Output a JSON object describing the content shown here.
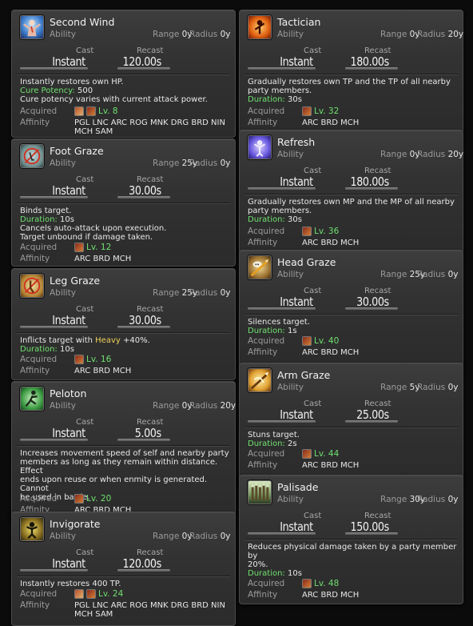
{
  "labels": {
    "cast": "Cast",
    "recast": "Recast",
    "range": "Range",
    "radius": "Radius",
    "acquired": "Acquired",
    "affinity": "Affinity"
  },
  "left": [
    {
      "name": "Second Wind",
      "type": "Ability",
      "range": "0y",
      "radius": "0y",
      "cast": "Instant",
      "recast": "120.00s",
      "desc_line1": "Instantly restores own HP.",
      "potency_label": "Cure Potency:",
      "potency_value": "500",
      "desc_line3": "Cure potency varies with current attack power.",
      "level": "Lv. 8",
      "affinity": "PGL LNC ARC ROG MNK DRG BRD NIN MCH SAM",
      "icon": "second-wind-icon"
    },
    {
      "name": "Foot Graze",
      "type": "Ability",
      "range": "25y",
      "radius": "0y",
      "cast": "Instant",
      "recast": "30.00s",
      "desc_line1": "Binds target.",
      "duration_label": "Duration:",
      "duration_value": "10s",
      "desc_line3": "Cancels auto-attack upon execution.",
      "desc_line4": "Target unbound if damage taken.",
      "level": "Lv. 12",
      "affinity": "ARC BRD MCH",
      "icon": "foot-graze-icon"
    },
    {
      "name": "Leg Graze",
      "type": "Ability",
      "range": "25y",
      "radius": "0y",
      "cast": "Instant",
      "recast": "30.00s",
      "desc_pre": "Inflicts target with ",
      "desc_heavy": "Heavy",
      "desc_post": " +40%.",
      "duration_label": "Duration:",
      "duration_value": "10s",
      "level": "Lv. 16",
      "affinity": "ARC BRD MCH",
      "icon": "leg-graze-icon"
    },
    {
      "name": "Peloton",
      "type": "Ability",
      "range": "0y",
      "radius": "20y",
      "cast": "Instant",
      "recast": "5.00s",
      "desc_line1": "Increases movement speed of self and nearby party",
      "desc_line2": "members as long as they remain within distance. Effect",
      "desc_line3": "ends upon reuse or when enmity is generated. Cannot",
      "desc_line4": "be used in battle.",
      "level": "Lv. 20",
      "affinity": "ARC BRD MCH",
      "icon": "peloton-icon"
    },
    {
      "name": "Invigorate",
      "type": "Ability",
      "range": "0y",
      "radius": "0y",
      "cast": "Instant",
      "recast": "120.00s",
      "desc_line1": "Instantly restores 400 TP.",
      "level": "Lv. 24",
      "affinity": "PGL LNC ARC ROG MNK DRG BRD NIN MCH SAM",
      "icon": "invigorate-icon"
    }
  ],
  "right": [
    {
      "name": "Tactician",
      "type": "Ability",
      "range": "0y",
      "radius": "20y",
      "cast": "Instant",
      "recast": "180.00s",
      "desc_line1": "Gradually restores own TP and the TP of all nearby",
      "desc_line2": "party members.",
      "duration_label": "Duration:",
      "duration_value": "30s",
      "level": "Lv. 32",
      "affinity": "ARC BRD MCH",
      "icon": "tactician-icon"
    },
    {
      "name": "Refresh",
      "type": "Ability",
      "range": "0y",
      "radius": "20y",
      "cast": "Instant",
      "recast": "180.00s",
      "desc_line1": "Gradually restores own MP and the MP of all nearby",
      "desc_line2": "party members.",
      "duration_label": "Duration:",
      "duration_value": "30s",
      "level": "Lv. 36",
      "affinity": "ARC BRD MCH",
      "icon": "refresh-icon"
    },
    {
      "name": "Head Graze",
      "type": "Ability",
      "range": "25y",
      "radius": "0y",
      "cast": "Instant",
      "recast": "30.00s",
      "desc_line1": "Silences target.",
      "duration_label": "Duration:",
      "duration_value": "1s",
      "level": "Lv. 40",
      "affinity": "ARC BRD MCH",
      "icon": "head-graze-icon"
    },
    {
      "name": "Arm Graze",
      "type": "Ability",
      "range": "5y",
      "radius": "0y",
      "cast": "Instant",
      "recast": "25.00s",
      "desc_line1": "Stuns target.",
      "duration_label": "Duration:",
      "duration_value": "2s",
      "level": "Lv. 44",
      "affinity": "ARC BRD MCH",
      "icon": "arm-graze-icon"
    },
    {
      "name": "Palisade",
      "type": "Ability",
      "range": "30y",
      "radius": "0y",
      "cast": "Instant",
      "recast": "150.00s",
      "desc_line1": "Reduces physical damage taken by a party member by",
      "desc_line2": "20%.",
      "duration_label": "Duration:",
      "duration_value": "10s",
      "level": "Lv. 48",
      "affinity": "ARC BRD MCH",
      "icon": "palisade-icon"
    }
  ]
}
